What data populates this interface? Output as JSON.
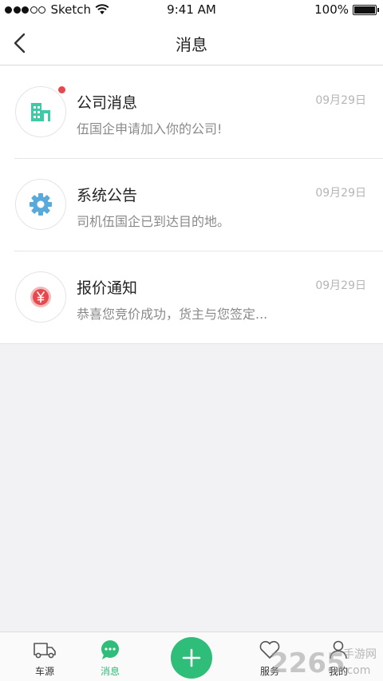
{
  "status_bar": {
    "carrier": "Sketch",
    "time": "9:41 AM",
    "battery": "100%"
  },
  "nav": {
    "title": "消息",
    "back_icon": "chevron-left-icon"
  },
  "messages": [
    {
      "title": "公司消息",
      "preview": "伍国企申请加入你的公司!",
      "date": "09月29日",
      "icon": "company-building-icon",
      "icon_color": "#3ec9a7",
      "unread": true
    },
    {
      "title": "系统公告",
      "preview": "司机伍国企已到达目的地。",
      "date": "09月29日",
      "icon": "gear-icon",
      "icon_color": "#5aa9db",
      "unread": false
    },
    {
      "title": "报价通知",
      "preview": "恭喜您竞价成功，货主与您签定...",
      "date": "09月29日",
      "icon": "yen-coin-icon",
      "icon_color": "#e5484d",
      "unread": false
    }
  ],
  "tabs": [
    {
      "label": "车源",
      "icon": "truck-icon",
      "active": false
    },
    {
      "label": "消息",
      "icon": "chat-bubble-icon",
      "active": true
    },
    {
      "label": "服务",
      "icon": "heart-icon",
      "active": false
    },
    {
      "label": "我的",
      "icon": "person-icon",
      "active": false
    }
  ],
  "add_button": {
    "icon": "plus-icon"
  },
  "watermark": {
    "text_big": "2265",
    "text_small": "手游网",
    "text_com": ".com"
  },
  "colors": {
    "accent": "#2fbd7a",
    "unread": "#e5484d",
    "date": "#b5b5b5",
    "preview": "#8a8a8a"
  }
}
